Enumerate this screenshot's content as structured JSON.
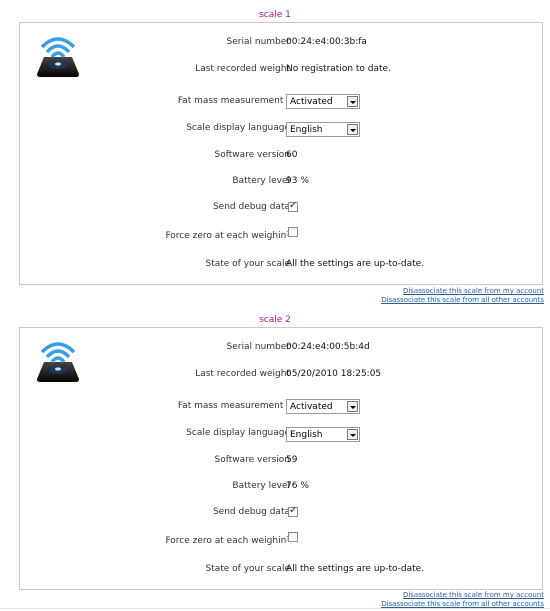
{
  "scales": [
    {
      "title": "scale 1",
      "icon": "wifi-scale-icon",
      "serial_number": {
        "label": "Serial number",
        "value": "00:24:e4:00:3b:fa"
      },
      "last_weight": {
        "label": "Last recorded weight",
        "value": "No registration to date."
      },
      "fat_mass": {
        "label": "Fat mass measurement",
        "help": "?",
        "value": "Activated"
      },
      "display_language": {
        "label": "Scale display language",
        "value": "English"
      },
      "software_version": {
        "label": "Software version",
        "value": "60"
      },
      "battery_level": {
        "label": "Battery level",
        "value": "93 %"
      },
      "send_debug": {
        "label": "Send debug data",
        "checked": true
      },
      "force_zero": {
        "label": "Force zero at each weighin",
        "help": "?",
        "checked": false
      },
      "state": {
        "label": "State of your scale",
        "value": "All the settings are up-to-date."
      },
      "links": {
        "disassociate_mine": "Disassociate this scale from my account",
        "disassociate_others": "Disassociate this scale from all other accounts"
      }
    },
    {
      "title": "scale 2",
      "icon": "wifi-scale-icon",
      "serial_number": {
        "label": "Serial number",
        "value": "00:24:e4:00:5b:4d"
      },
      "last_weight": {
        "label": "Last recorded weight",
        "value": "05/20/2010 18:25:05"
      },
      "fat_mass": {
        "label": "Fat mass measurement",
        "help": "?",
        "value": "Activated"
      },
      "display_language": {
        "label": "Scale display language",
        "value": "English"
      },
      "software_version": {
        "label": "Software version",
        "value": "59"
      },
      "battery_level": {
        "label": "Battery level",
        "value": "76 %"
      },
      "send_debug": {
        "label": "Send debug data",
        "checked": true
      },
      "force_zero": {
        "label": "Force zero at each weighin",
        "help": "?",
        "checked": false
      },
      "state": {
        "label": "State of your scale",
        "value": "All the settings are up-to-date."
      },
      "links": {
        "disassociate_mine": "Disassociate this scale from my account",
        "disassociate_others": "Disassociate this scale from all other accounts"
      }
    }
  ],
  "colors": {
    "title": "#b0158a",
    "link": "#2a5d9f",
    "border": "#c8c8c8"
  }
}
